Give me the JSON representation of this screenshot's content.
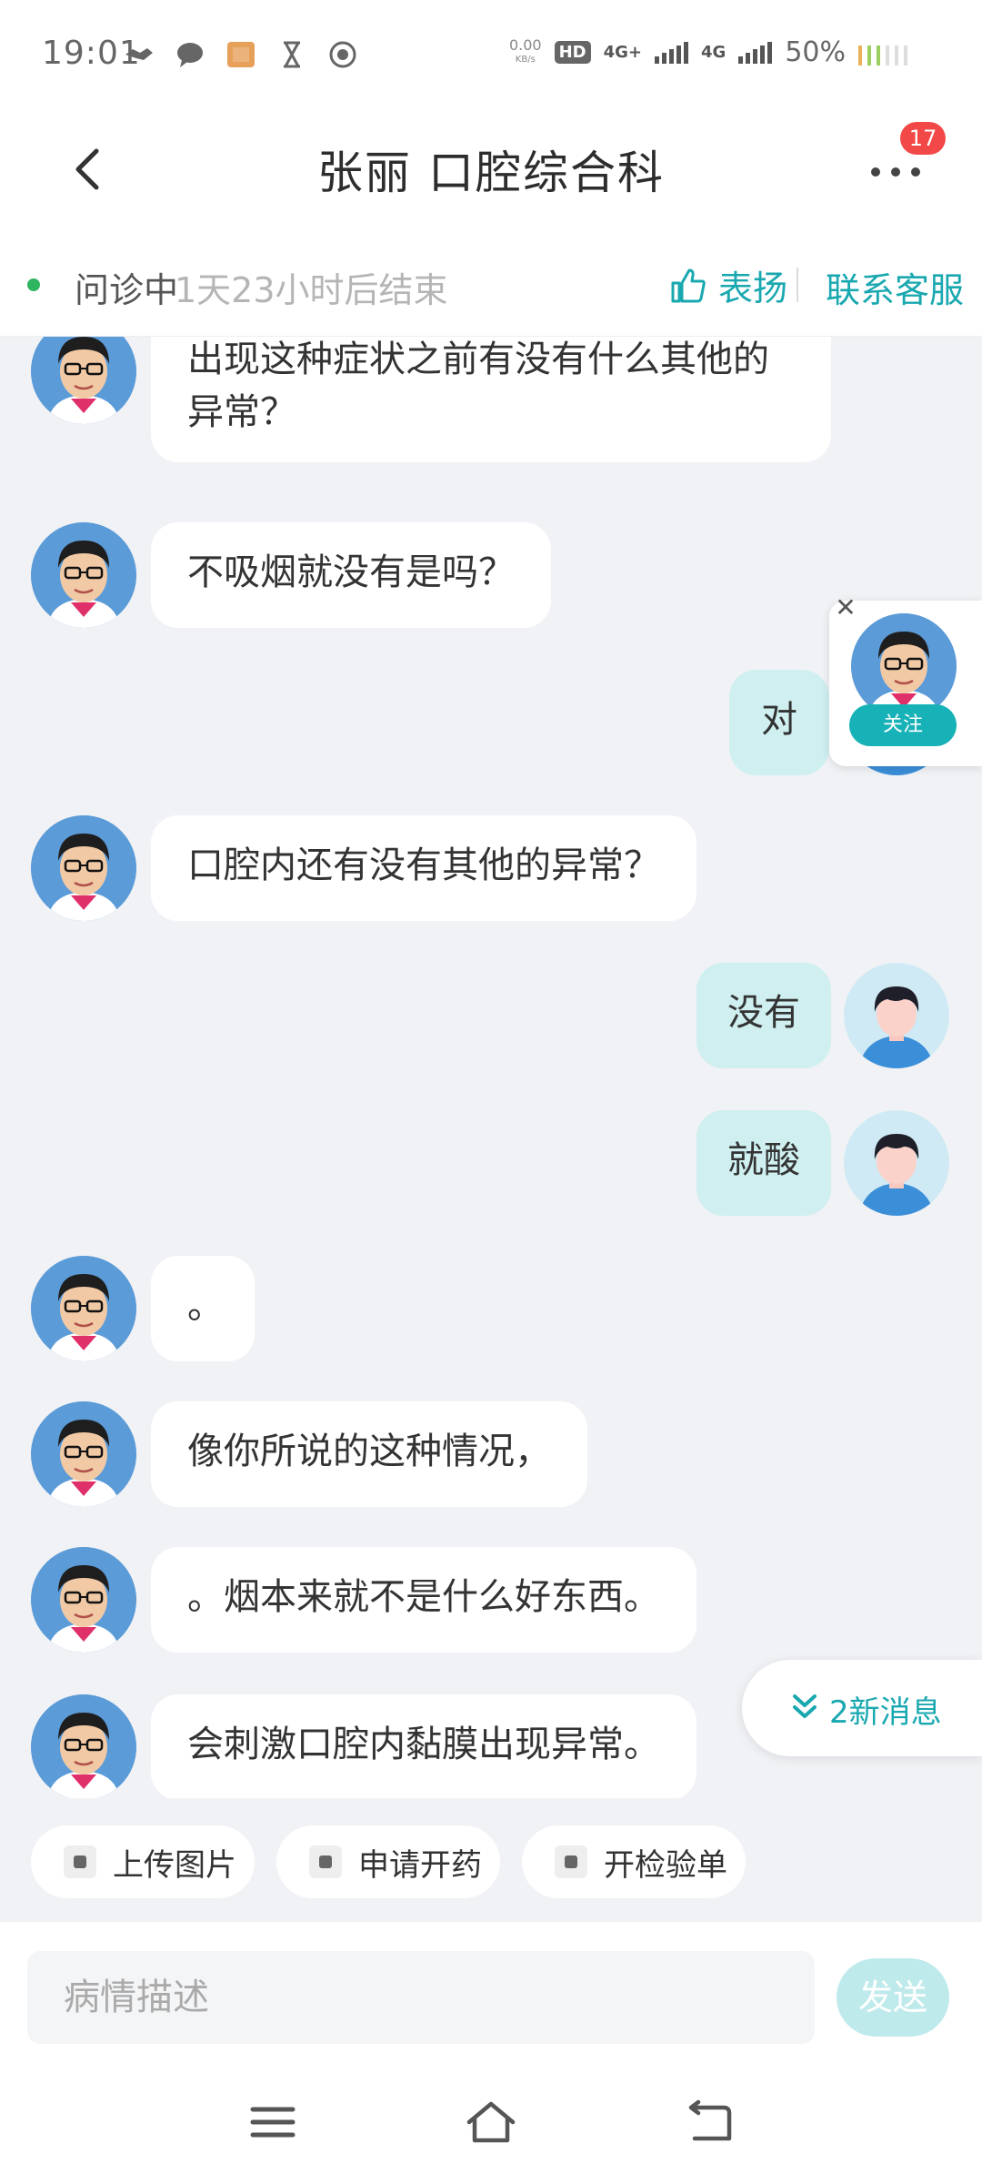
{
  "status_bar": {
    "time": "19:01",
    "speed_top": "0.00",
    "speed_unit": "KB/s",
    "hd": "HD",
    "net1": "4G+",
    "net2": "4G",
    "battery": "50%"
  },
  "header": {
    "title": "张丽 口腔综合科",
    "badge": "17"
  },
  "consult": {
    "status": "问诊中",
    "remaining": "1天23小时后结束",
    "praise_label": "表扬",
    "contact_label": "联系客服"
  },
  "messages": [
    {
      "sender": "doctor",
      "text": "出现这种症状之前有没有什么其他的异常？"
    },
    {
      "sender": "doctor",
      "text": "不吸烟就没有是吗？"
    },
    {
      "sender": "user",
      "text": "对"
    },
    {
      "sender": "doctor",
      "text": "口腔内还有没有其他的异常？"
    },
    {
      "sender": "user",
      "text": "没有"
    },
    {
      "sender": "user",
      "text": "就酸"
    },
    {
      "sender": "doctor",
      "text": "。"
    },
    {
      "sender": "doctor",
      "text": "像你所说的这种情况，"
    },
    {
      "sender": "doctor",
      "text": "。烟本来就不是什么好东西。"
    },
    {
      "sender": "doctor",
      "text": "会刺激口腔内黏膜出现异常。"
    }
  ],
  "follow_card": {
    "button": "关注",
    "close": "✕"
  },
  "new_messages": "2新消息",
  "quick_actions": [
    {
      "label": "上传图片",
      "icon": "image-icon"
    },
    {
      "label": "申请开药",
      "icon": "medicine-icon"
    },
    {
      "label": "开检验单",
      "icon": "lab-test-icon"
    }
  ],
  "input": {
    "placeholder": "病情描述",
    "send_label": "发送"
  },
  "colors": {
    "accent": "#1aa8b0",
    "chat_bg": "#f0f2f5",
    "user_bubble": "#cfeff0",
    "badge": "#f24848",
    "online_dot": "#2fb45f"
  }
}
